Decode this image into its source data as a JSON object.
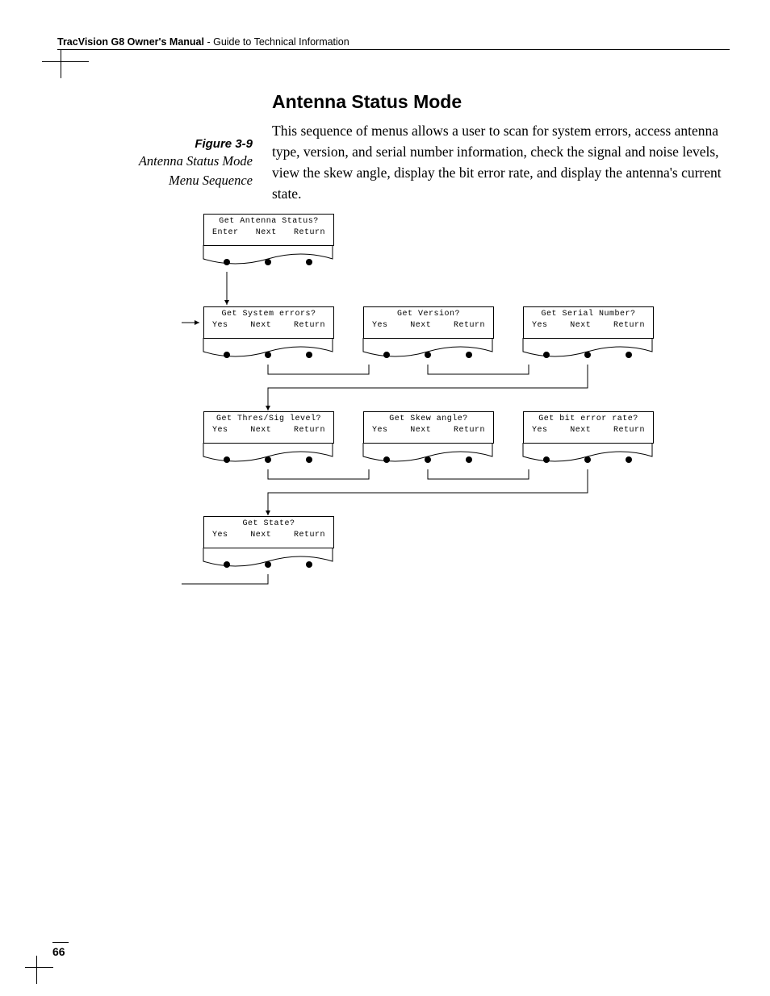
{
  "header": {
    "bold": "TracVision G8 Owner's Manual",
    "sep": " - ",
    "light": "Guide to Technical Information"
  },
  "heading": "Antenna Status Mode",
  "body": "This sequence of menus allows a user to scan for system errors, access antenna type, version, and serial number information, check the signal and noise levels, view the skew angle, display the bit error rate, and display the antenna's current state.",
  "fig": {
    "num": "Figure 3-9",
    "title1": "Antenna Status Mode",
    "title2": "Menu Sequence"
  },
  "pagenum": "66",
  "menus": {
    "antstat": {
      "title": "Get Antenna Status?",
      "b1": "Enter",
      "b2": "Next",
      "b3": "Return"
    },
    "syserr": {
      "title": "Get System errors?",
      "b1": "Yes",
      "b2": "Next",
      "b3": "Return"
    },
    "version": {
      "title": "Get Version?",
      "b1": "Yes",
      "b2": "Next",
      "b3": "Return"
    },
    "serial": {
      "title": "Get Serial Number?",
      "b1": "Yes",
      "b2": "Next",
      "b3": "Return"
    },
    "thres": {
      "title": "Get Thres/Sig level?",
      "b1": "Yes",
      "b2": "Next",
      "b3": "Return"
    },
    "skew": {
      "title": "Get Skew angle?",
      "b1": "Yes",
      "b2": "Next",
      "b3": "Return"
    },
    "biterr": {
      "title": "Get bit error rate?",
      "b1": "Yes",
      "b2": "Next",
      "b3": "Return"
    },
    "state": {
      "title": "Get State?",
      "b1": "Yes",
      "b2": "Next",
      "b3": "Return"
    }
  }
}
